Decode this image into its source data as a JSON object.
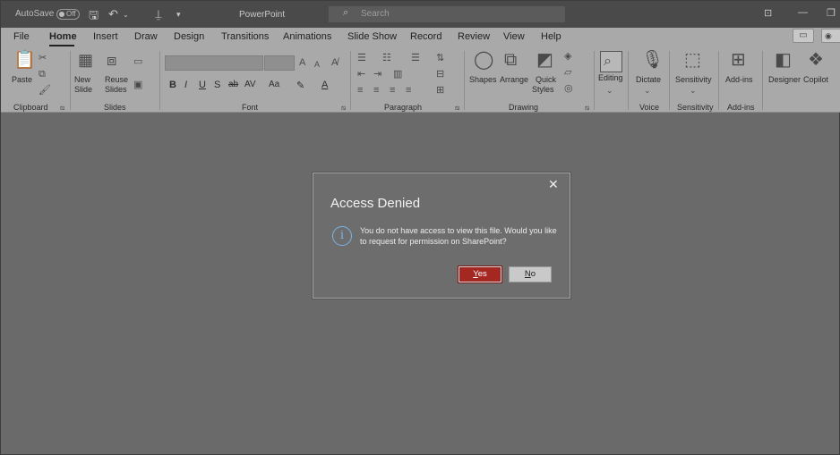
{
  "titlebar": {
    "autosave_label": "AutoSave",
    "autosave_state": "Off",
    "app_title": "PowerPoint",
    "search_placeholder": "Search"
  },
  "tabs": [
    "File",
    "Home",
    "Insert",
    "Draw",
    "Design",
    "Transitions",
    "Animations",
    "Slide Show",
    "Record",
    "Review",
    "View",
    "Help"
  ],
  "active_tab": "Home",
  "ribbon": {
    "clipboard": {
      "paste": "Paste",
      "group": "Clipboard"
    },
    "slides": {
      "new_slide_1": "New",
      "new_slide_2": "Slide",
      "reuse_1": "Reuse",
      "reuse_2": "Slides",
      "group": "Slides"
    },
    "font": {
      "group": "Font"
    },
    "paragraph": {
      "group": "Paragraph"
    },
    "drawing": {
      "shapes": "Shapes",
      "arrange": "Arrange",
      "quick_1": "Quick",
      "quick_2": "Styles",
      "group": "Drawing"
    },
    "editing": {
      "label": "Editing"
    },
    "voice": {
      "dictate": "Dictate",
      "group": "Voice"
    },
    "sensitivity": {
      "button": "Sensitivity",
      "group": "Sensitivity"
    },
    "addins": {
      "button": "Add-ins",
      "group": "Add-ins"
    },
    "designer": "Designer",
    "copilot": "Copilot"
  },
  "dialog": {
    "title": "Access Denied",
    "message": "You do not have access to view this file. Would you like to request for permission on SharePoint?",
    "yes_key": "Y",
    "yes_rest": "es",
    "no_key": "N",
    "no_rest": "o"
  },
  "colors": {
    "yes_button": "#a52722",
    "info_icon": "#7ab4e6",
    "ribbon": "#a9a9a9",
    "background": "#6a6a6a"
  }
}
